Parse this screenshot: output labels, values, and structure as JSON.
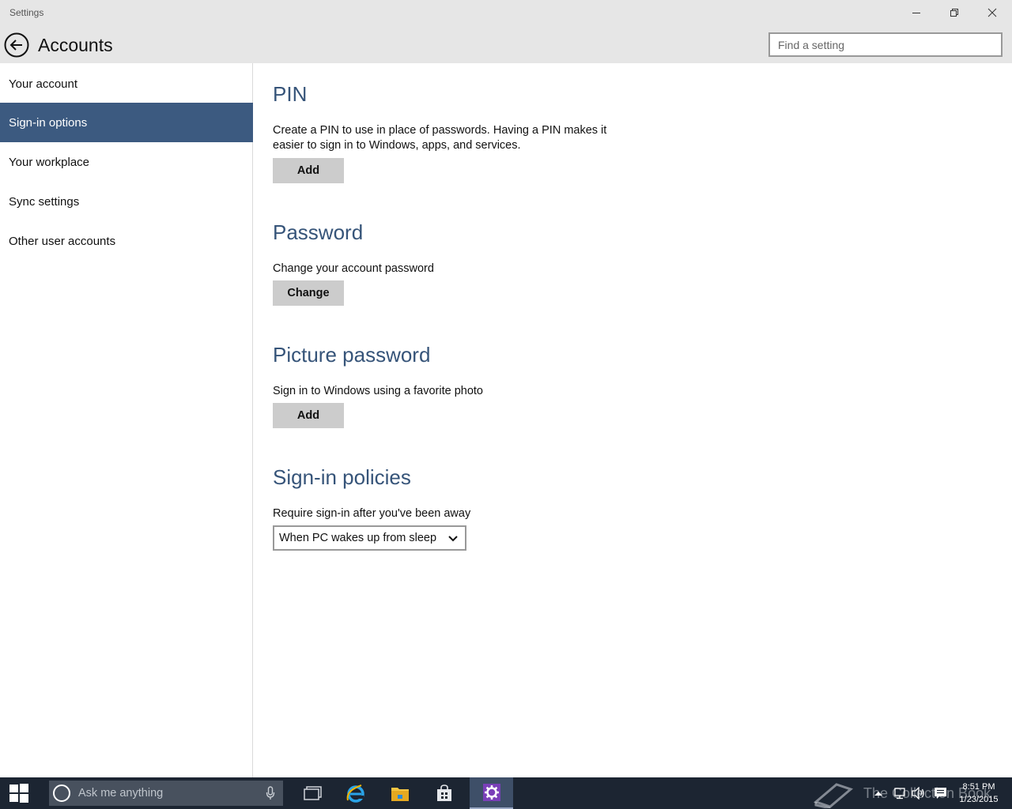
{
  "window": {
    "title": "Settings"
  },
  "header": {
    "page_title": "Accounts",
    "search_placeholder": "Find a setting"
  },
  "sidebar": {
    "items": [
      {
        "label": "Your account",
        "selected": false
      },
      {
        "label": "Sign-in options",
        "selected": true
      },
      {
        "label": "Your workplace",
        "selected": false
      },
      {
        "label": "Sync settings",
        "selected": false
      },
      {
        "label": "Other user accounts",
        "selected": false
      }
    ]
  },
  "sections": {
    "pin": {
      "title": "PIN",
      "description": "Create a PIN to use in place of passwords. Having a PIN makes it easier to sign in to Windows, apps, and services.",
      "button": "Add"
    },
    "password": {
      "title": "Password",
      "description": "Change your account password",
      "button": "Change"
    },
    "picture_password": {
      "title": "Picture password",
      "description": "Sign in to Windows using a favorite photo",
      "button": "Add"
    },
    "policies": {
      "title": "Sign-in policies",
      "description": "Require sign-in after you've been away",
      "selected_option": "When PC wakes up from sleep"
    }
  },
  "taskbar": {
    "search_placeholder": "Ask me anything",
    "time": "8:51 PM",
    "date": "1/23/2015",
    "watermark": "The Collection Book",
    "accent_color": "#3c5a80",
    "title_color": "#365479"
  }
}
